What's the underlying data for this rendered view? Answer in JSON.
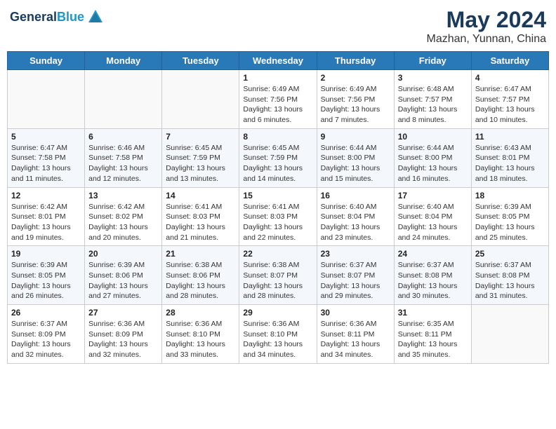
{
  "header": {
    "logo_general": "General",
    "logo_blue": "Blue",
    "main_title": "May 2024",
    "sub_title": "Mazhan, Yunnan, China"
  },
  "weekdays": [
    "Sunday",
    "Monday",
    "Tuesday",
    "Wednesday",
    "Thursday",
    "Friday",
    "Saturday"
  ],
  "weeks": [
    [
      {
        "day": "",
        "info": ""
      },
      {
        "day": "",
        "info": ""
      },
      {
        "day": "",
        "info": ""
      },
      {
        "day": "1",
        "info": "Sunrise: 6:49 AM\nSunset: 7:56 PM\nDaylight: 13 hours\nand 6 minutes."
      },
      {
        "day": "2",
        "info": "Sunrise: 6:49 AM\nSunset: 7:56 PM\nDaylight: 13 hours\nand 7 minutes."
      },
      {
        "day": "3",
        "info": "Sunrise: 6:48 AM\nSunset: 7:57 PM\nDaylight: 13 hours\nand 8 minutes."
      },
      {
        "day": "4",
        "info": "Sunrise: 6:47 AM\nSunset: 7:57 PM\nDaylight: 13 hours\nand 10 minutes."
      }
    ],
    [
      {
        "day": "5",
        "info": "Sunrise: 6:47 AM\nSunset: 7:58 PM\nDaylight: 13 hours\nand 11 minutes."
      },
      {
        "day": "6",
        "info": "Sunrise: 6:46 AM\nSunset: 7:58 PM\nDaylight: 13 hours\nand 12 minutes."
      },
      {
        "day": "7",
        "info": "Sunrise: 6:45 AM\nSunset: 7:59 PM\nDaylight: 13 hours\nand 13 minutes."
      },
      {
        "day": "8",
        "info": "Sunrise: 6:45 AM\nSunset: 7:59 PM\nDaylight: 13 hours\nand 14 minutes."
      },
      {
        "day": "9",
        "info": "Sunrise: 6:44 AM\nSunset: 8:00 PM\nDaylight: 13 hours\nand 15 minutes."
      },
      {
        "day": "10",
        "info": "Sunrise: 6:44 AM\nSunset: 8:00 PM\nDaylight: 13 hours\nand 16 minutes."
      },
      {
        "day": "11",
        "info": "Sunrise: 6:43 AM\nSunset: 8:01 PM\nDaylight: 13 hours\nand 18 minutes."
      }
    ],
    [
      {
        "day": "12",
        "info": "Sunrise: 6:42 AM\nSunset: 8:01 PM\nDaylight: 13 hours\nand 19 minutes."
      },
      {
        "day": "13",
        "info": "Sunrise: 6:42 AM\nSunset: 8:02 PM\nDaylight: 13 hours\nand 20 minutes."
      },
      {
        "day": "14",
        "info": "Sunrise: 6:41 AM\nSunset: 8:03 PM\nDaylight: 13 hours\nand 21 minutes."
      },
      {
        "day": "15",
        "info": "Sunrise: 6:41 AM\nSunset: 8:03 PM\nDaylight: 13 hours\nand 22 minutes."
      },
      {
        "day": "16",
        "info": "Sunrise: 6:40 AM\nSunset: 8:04 PM\nDaylight: 13 hours\nand 23 minutes."
      },
      {
        "day": "17",
        "info": "Sunrise: 6:40 AM\nSunset: 8:04 PM\nDaylight: 13 hours\nand 24 minutes."
      },
      {
        "day": "18",
        "info": "Sunrise: 6:39 AM\nSunset: 8:05 PM\nDaylight: 13 hours\nand 25 minutes."
      }
    ],
    [
      {
        "day": "19",
        "info": "Sunrise: 6:39 AM\nSunset: 8:05 PM\nDaylight: 13 hours\nand 26 minutes."
      },
      {
        "day": "20",
        "info": "Sunrise: 6:39 AM\nSunset: 8:06 PM\nDaylight: 13 hours\nand 27 minutes."
      },
      {
        "day": "21",
        "info": "Sunrise: 6:38 AM\nSunset: 8:06 PM\nDaylight: 13 hours\nand 28 minutes."
      },
      {
        "day": "22",
        "info": "Sunrise: 6:38 AM\nSunset: 8:07 PM\nDaylight: 13 hours\nand 28 minutes."
      },
      {
        "day": "23",
        "info": "Sunrise: 6:37 AM\nSunset: 8:07 PM\nDaylight: 13 hours\nand 29 minutes."
      },
      {
        "day": "24",
        "info": "Sunrise: 6:37 AM\nSunset: 8:08 PM\nDaylight: 13 hours\nand 30 minutes."
      },
      {
        "day": "25",
        "info": "Sunrise: 6:37 AM\nSunset: 8:08 PM\nDaylight: 13 hours\nand 31 minutes."
      }
    ],
    [
      {
        "day": "26",
        "info": "Sunrise: 6:37 AM\nSunset: 8:09 PM\nDaylight: 13 hours\nand 32 minutes."
      },
      {
        "day": "27",
        "info": "Sunrise: 6:36 AM\nSunset: 8:09 PM\nDaylight: 13 hours\nand 32 minutes."
      },
      {
        "day": "28",
        "info": "Sunrise: 6:36 AM\nSunset: 8:10 PM\nDaylight: 13 hours\nand 33 minutes."
      },
      {
        "day": "29",
        "info": "Sunrise: 6:36 AM\nSunset: 8:10 PM\nDaylight: 13 hours\nand 34 minutes."
      },
      {
        "day": "30",
        "info": "Sunrise: 6:36 AM\nSunset: 8:11 PM\nDaylight: 13 hours\nand 34 minutes."
      },
      {
        "day": "31",
        "info": "Sunrise: 6:35 AM\nSunset: 8:11 PM\nDaylight: 13 hours\nand 35 minutes."
      },
      {
        "day": "",
        "info": ""
      }
    ]
  ]
}
